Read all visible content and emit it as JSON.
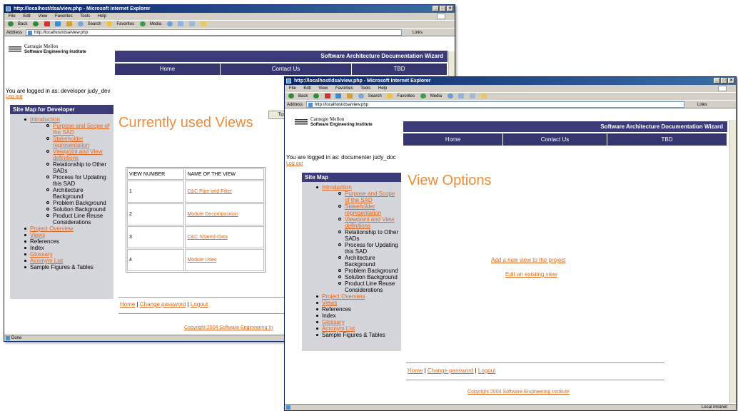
{
  "back_window": {
    "title": "http://localhost/dsa/view.php - Microsoft Internet Explorer",
    "window_buttons": [
      "_",
      "□",
      "×"
    ],
    "menu": [
      "File",
      "Edit",
      "View",
      "Favorites",
      "Tools",
      "Help"
    ],
    "toolbar": [
      "Back",
      "Search",
      "Favorites",
      "Media"
    ],
    "address_label": "Address",
    "address": "http://localhost/dsa/view.php",
    "links_label": "Links",
    "logo_line1": "Carnegie Mellon",
    "logo_line2": "Software Engineering Institute",
    "banner": "Software Architecture Documentation Wizard",
    "nav": [
      "Home",
      "Contact Us",
      "TBD"
    ],
    "logged_in": "You are logged in as: developer judy_dev",
    "logout": "Log out",
    "sitemap_title": "Site Map for Developer",
    "heading": "Currently used Views",
    "tips": "Tips",
    "table": {
      "headers": [
        "VIEW NUMBER",
        "NAME OF THE VIEW"
      ],
      "rows": [
        [
          "1",
          "C&C Pipe-and-Filter"
        ],
        [
          "2",
          "Module Decomposition"
        ],
        [
          "3",
          "C&C Shared-Data"
        ],
        [
          "4",
          "Module Uses"
        ]
      ]
    },
    "footer": {
      "home": "Home",
      "change_password": "Change password",
      "logout": "Logout"
    },
    "copyright": "Copyright 2004 Software Engineering In",
    "status": "Done"
  },
  "front_window": {
    "title": "http://localhost/dsa/view.php - Microsoft Internet Explorer",
    "window_buttons": [
      "_",
      "□",
      "×"
    ],
    "menu": [
      "File",
      "Edit",
      "View",
      "Favorites",
      "Tools",
      "Help"
    ],
    "toolbar": [
      "Back",
      "Search",
      "Favorites",
      "Media"
    ],
    "address_label": "Address",
    "address": "http://localhost/dsa/view.php",
    "links_label": "Links",
    "logo_line1": "Carnegie Mellon",
    "logo_line2": "Software Engineering Institute",
    "banner": "Software Architecture Documentation Wizard",
    "nav": [
      "Home",
      "Contact Us",
      "TBD"
    ],
    "logged_in": "You are logged in as: documenter judy_doc",
    "logout": "Log out",
    "sitemap_title": "Site Map",
    "heading": "View Options",
    "add_view": "Add a new view to the project",
    "edit_view": "Edit an existing view",
    "footer": {
      "home": "Home",
      "change_password": "Change password",
      "logout": "Logout"
    },
    "copyright": "Copyright 2004 Software Engineering Institute",
    "status_zone": "Local intranet"
  },
  "sitemap": {
    "introduction": "Introduction",
    "intro_sub": [
      {
        "label": "Purpose and Scope of the SAD",
        "link": true
      },
      {
        "label": "Stakeholder representation",
        "link": true
      },
      {
        "label": "Viewpoint and View definitions",
        "link": true
      },
      {
        "label": "Relationship to Other SADs",
        "link": false
      },
      {
        "label": "Process for Updating this SAD",
        "link": false
      },
      {
        "label": "Architecture Background",
        "link": false
      },
      {
        "label": "Problem Background",
        "link": false
      },
      {
        "label": "Solution Background",
        "link": false
      },
      {
        "label": "Product Line Reuse Considerations",
        "link": false
      }
    ],
    "rest": [
      {
        "label": "Project Overview",
        "link": true
      },
      {
        "label": "Views",
        "link": true
      },
      {
        "label": "References",
        "link": false
      },
      {
        "label": "Index",
        "link": false
      },
      {
        "label": "Glossary",
        "link": true
      },
      {
        "label": "Acronym List",
        "link": true
      },
      {
        "label": "Sample Figures & Tables",
        "link": false
      }
    ]
  },
  "colors": {
    "accent_orange": "#e0671f",
    "heading_orange": "#f08b38",
    "nav_blue": "#35356f",
    "sidebar_gray": "#d5d5dc"
  }
}
